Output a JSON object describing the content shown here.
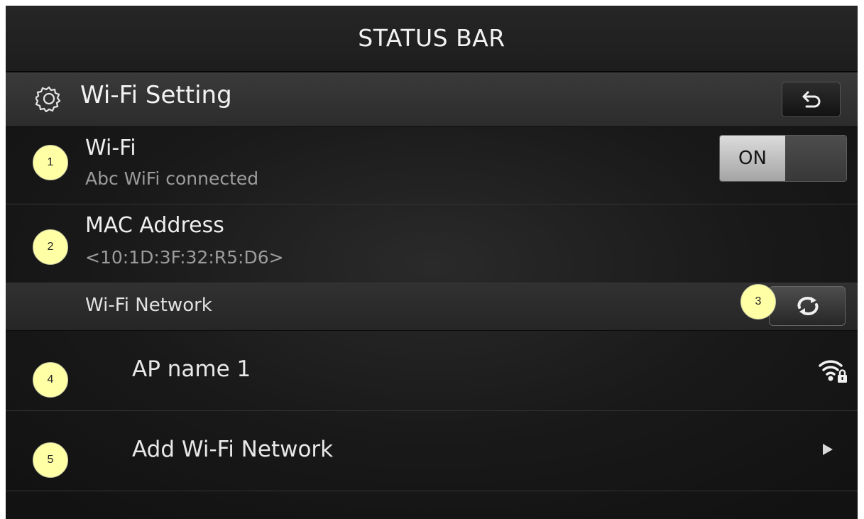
{
  "status_bar": {
    "label": "STATUS BAR"
  },
  "header": {
    "title": "Wi-Fi Setting",
    "gear_icon": "gear-icon",
    "back_icon": "back-arrow-icon"
  },
  "wifi": {
    "label": "Wi-Fi",
    "status": "Abc WiFi connected",
    "toggle_state": "ON"
  },
  "mac": {
    "label": "MAC Address",
    "value": "<10:1D:3F:32:R5:D6>"
  },
  "network_section": {
    "label": "Wi-Fi Network",
    "refresh_icon": "refresh-icon"
  },
  "networks": [
    {
      "label": "AP name 1",
      "icon": "wifi-locked-icon"
    },
    {
      "label": "Add Wi-Fi Network",
      "icon": "play-arrow-icon"
    }
  ],
  "annotations": [
    "1",
    "2",
    "3",
    "4",
    "5"
  ],
  "colors": {
    "background": "#141414",
    "badge": "#ffffa6",
    "text": "#ededed",
    "subtext": "#9c9c9c"
  }
}
